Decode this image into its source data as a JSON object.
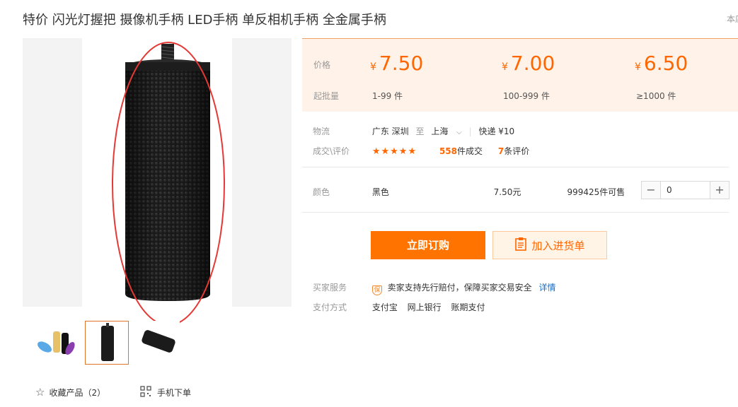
{
  "product": {
    "title": "特价 闪光灯握把 摄像机手柄 LED手柄 单反相机手柄 全金属手柄",
    "corner_text": "本店"
  },
  "gallery": {
    "thumbnail_count": 3,
    "active_thumbnail": 2,
    "favorite_label": "收藏产品（2）",
    "mobile_label": "手机下单"
  },
  "pricing": {
    "price_label": "价格",
    "moq_label": "起批量",
    "currency": "¥",
    "tiers": [
      {
        "price": "7.50",
        "range": "1-99 件"
      },
      {
        "price": "7.00",
        "range": "100-999 件"
      },
      {
        "price": "6.50",
        "range": "≥1000 件"
      }
    ]
  },
  "logistics": {
    "label": "物流",
    "from": "广东 深圳",
    "to_word": "至",
    "dest": "上海",
    "shipping": "快递 ¥10"
  },
  "reviews": {
    "label": "成交\\评价",
    "stars": "★★★★★",
    "deals_count": "558",
    "deals_suffix": "件成交",
    "review_count": "7",
    "review_suffix": "条评价"
  },
  "sku": {
    "label": "颜色",
    "color": "黑色",
    "price": "7.50元",
    "stock": "999425件可售",
    "quantity": "0",
    "minus": "−",
    "plus": "+"
  },
  "actions": {
    "buy_now": "立即订购",
    "add_to_cart": "加入进货单"
  },
  "service": {
    "buyer_label": "买家服务",
    "badge": "保",
    "guarantee_text": "卖家支持先行赔付，保障买家交易安全",
    "details_link": "详情",
    "payment_label": "支付方式",
    "payment_methods": [
      "支付宝",
      "网上银行",
      "账期支付"
    ]
  },
  "colors": {
    "accent": "#ff6600",
    "annotation_circle": "#e53935",
    "price_panel_bg": "#fff2e8",
    "link": "#1a6fc9"
  }
}
